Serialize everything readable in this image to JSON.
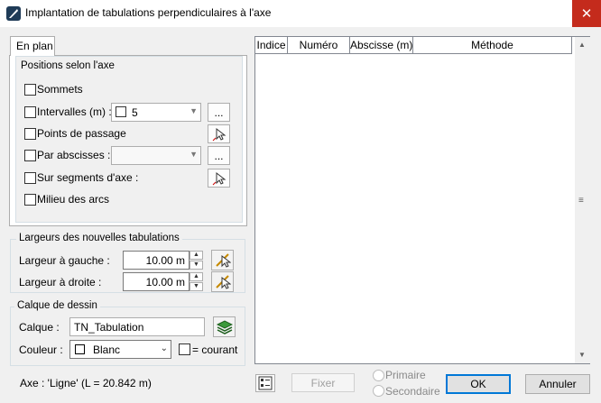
{
  "window": {
    "title": "Implantation de tabulations perpendiculaires à l'axe",
    "close_icon": "✕"
  },
  "tab": {
    "label": "En plan"
  },
  "positions": {
    "title": "Positions selon l'axe",
    "sommets_label": "Sommets",
    "intervalles_label": "Intervalles (m) :",
    "intervalles_value": "5",
    "points_passage_label": "Points de passage",
    "par_abscisses_label": "Par abscisses :",
    "sur_segments_label": "Sur segments d'axe :",
    "milieu_arcs_label": "Milieu des arcs",
    "ellipsis": "..."
  },
  "largeurs": {
    "title": "Largeurs des nouvelles tabulations",
    "gauche_label": "Largeur à gauche :",
    "gauche_value": "10.00 m",
    "droite_label": "Largeur à droite :",
    "droite_value": "10.00 m"
  },
  "calque": {
    "title": "Calque de dessin",
    "calque_label": "Calque :",
    "calque_value": "TN_Tabulation",
    "couleur_label": "Couleur :",
    "couleur_value": "Blanc",
    "courant_label": "= courant"
  },
  "table": {
    "columns": [
      "Indice",
      "Numéro",
      "Abscisse (m)",
      "Méthode"
    ],
    "rows": []
  },
  "footer": {
    "axe_info": "Axe : 'Ligne' (L = 20.842 m)",
    "fixer_label": "Fixer",
    "primaire_label": "Primaire",
    "secondaire_label": "Secondaire",
    "ok_label": "OK",
    "annuler_label": "Annuler"
  }
}
